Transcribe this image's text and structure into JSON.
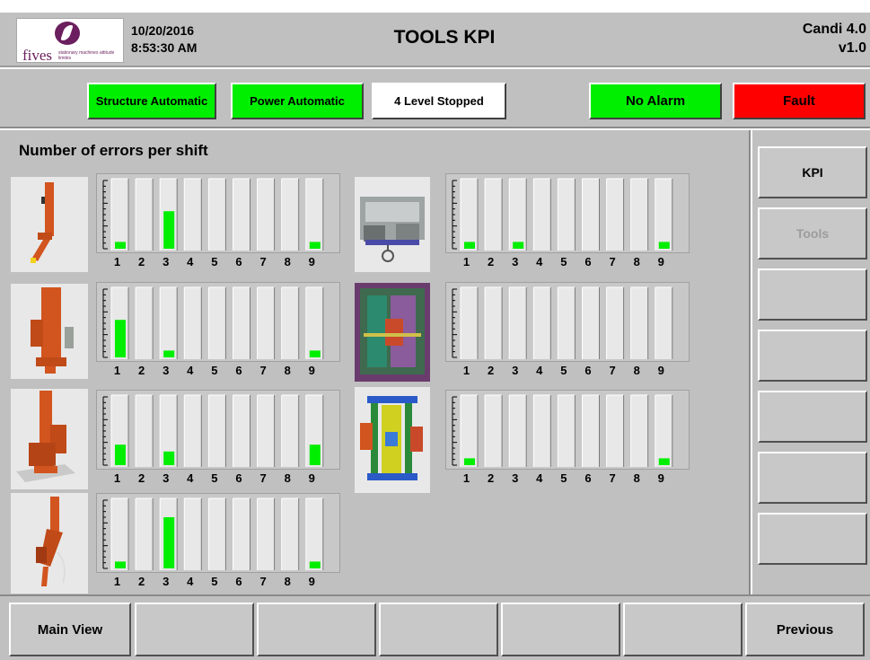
{
  "header": {
    "logo_text": "fives",
    "logo_sub": "stationary machines attitude limités",
    "date": "10/20/2016",
    "time": "8:53:30 AM",
    "title": "TOOLS KPI",
    "app_name": "Candi 4.0",
    "version": "v1.0"
  },
  "status": {
    "structure": "Structure Automatic",
    "power": "Power Automatic",
    "level": "4 Level Stopped",
    "alarm": "No Alarm",
    "fault": "Fault",
    "colors": {
      "ok": "#00ee00",
      "fault": "#ff0000",
      "neutral": "#ffffff"
    }
  },
  "main": {
    "section_title": "Number of errors per shift",
    "charts": [
      {
        "tool": "tool-1",
        "values": [
          0.1,
          0,
          0.55,
          0,
          0,
          0,
          0,
          0,
          0.1
        ]
      },
      {
        "tool": "tool-2",
        "values": [
          0.55,
          0,
          0.1,
          0,
          0,
          0,
          0,
          0,
          0.1
        ]
      },
      {
        "tool": "tool-3",
        "values": [
          0.3,
          0,
          0.2,
          0,
          0,
          0,
          0,
          0,
          0.3
        ]
      },
      {
        "tool": "tool-4",
        "values": [
          0.1,
          0,
          0.75,
          0,
          0,
          0,
          0,
          0,
          0.1
        ]
      },
      {
        "tool": "tool-5",
        "values": [
          0.1,
          0,
          0.1,
          0,
          0,
          0,
          0,
          0,
          0.1
        ]
      },
      {
        "tool": "tool-6",
        "values": [
          0,
          0,
          0,
          0,
          0,
          0,
          0,
          0,
          0
        ]
      },
      {
        "tool": "tool-7",
        "values": [
          0.1,
          0,
          0,
          0,
          0,
          0,
          0,
          0,
          0.1
        ]
      }
    ],
    "x_labels": [
      "1",
      "2",
      "3",
      "4",
      "5",
      "6",
      "7",
      "8",
      "9"
    ],
    "bar_color": "#00ee00"
  },
  "rightmenu": {
    "kpi": "KPI",
    "tools": "Tools"
  },
  "bottombar": {
    "main_view": "Main View",
    "previous": "Previous"
  }
}
